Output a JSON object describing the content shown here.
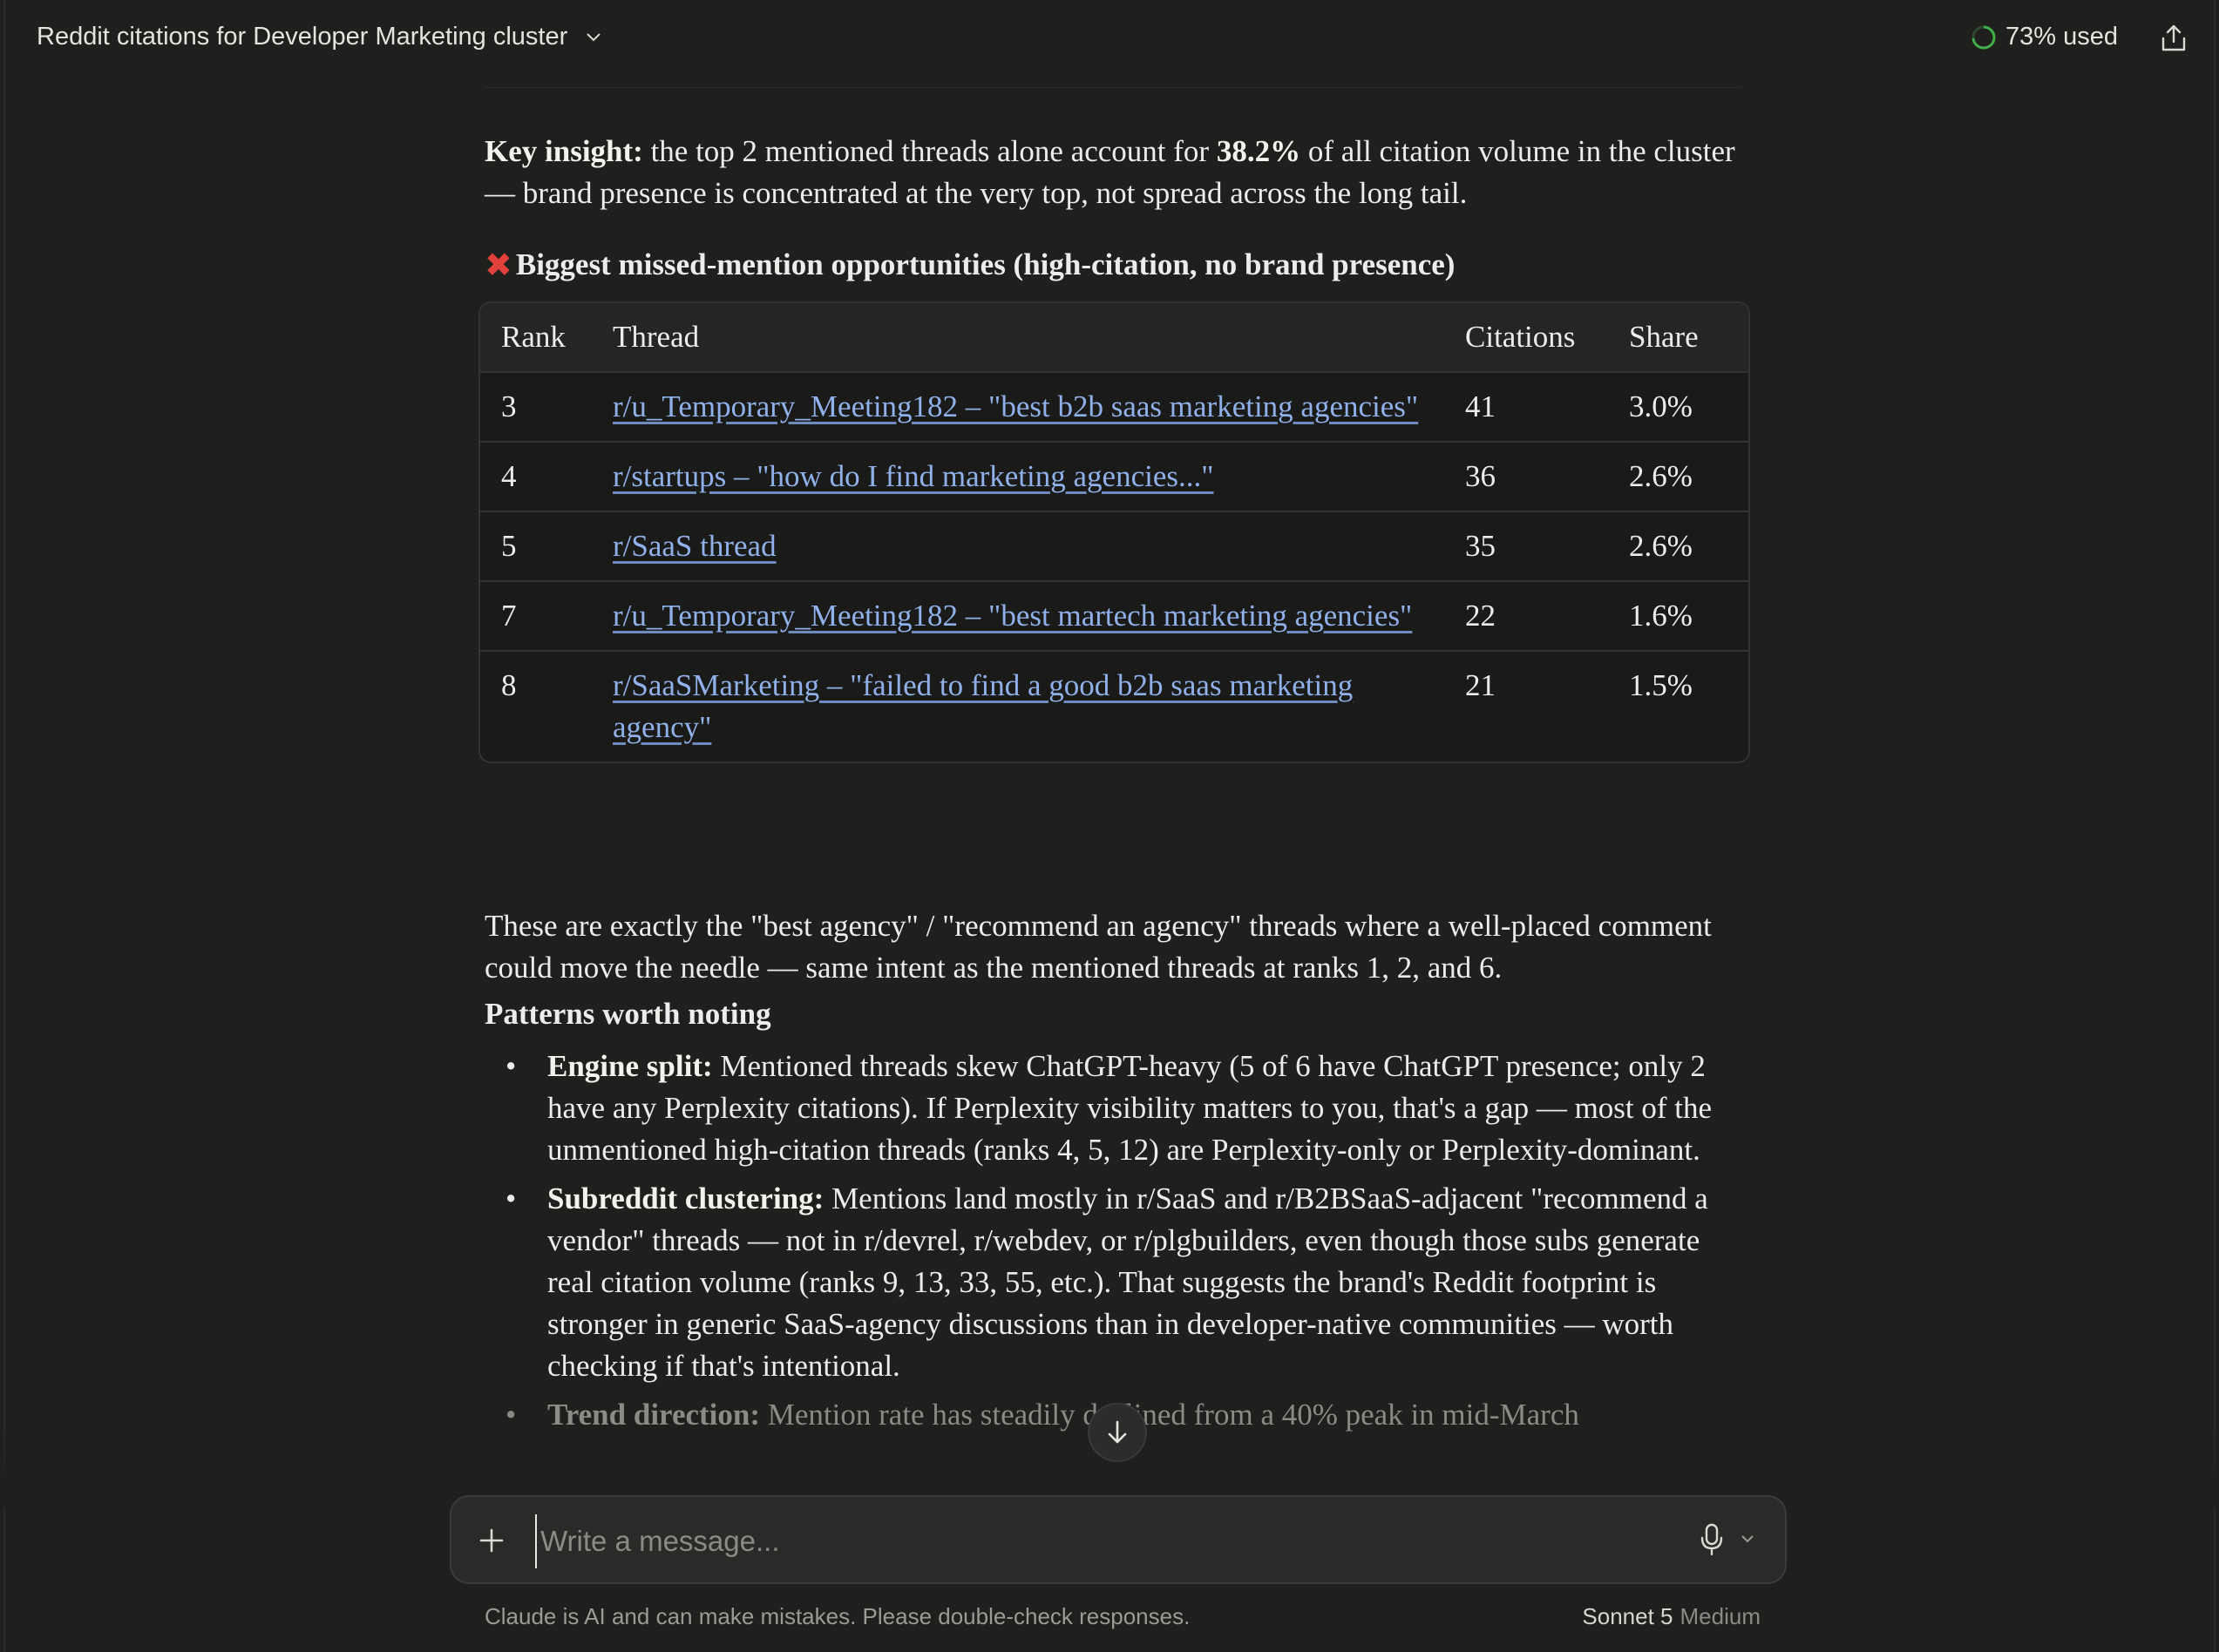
{
  "header": {
    "title": "Reddit citations for Developer Marketing cluster",
    "usage_label": "73% used",
    "usage_fraction": 0.73
  },
  "content": {
    "key_insight_label": "Key insight:",
    "key_insight_pre": " the top 2 mentioned threads alone account for ",
    "key_insight_value": "38.2%",
    "key_insight_post": " of all citation volume in the cluster — brand presence is concentrated at the very top, not spread across the long tail.",
    "missed_heading": "Biggest missed-mention opportunities (high-citation, no brand presence)",
    "table": {
      "headers": [
        "Rank",
        "Thread",
        "Citations",
        "Share"
      ],
      "rows": [
        {
          "rank": "3",
          "thread": "r/u_Temporary_Meeting182 – \"best b2b saas marketing agencies\"",
          "citations": "41",
          "share": "3.0%"
        },
        {
          "rank": "4",
          "thread": "r/startups – \"how do I find marketing agencies...\"",
          "citations": "36",
          "share": "2.6%"
        },
        {
          "rank": "5",
          "thread": "r/SaaS thread",
          "citations": "35",
          "share": "2.6%"
        },
        {
          "rank": "7",
          "thread": "r/u_Temporary_Meeting182 – \"best martech marketing agencies\"",
          "citations": "22",
          "share": "1.6%"
        },
        {
          "rank": "8",
          "thread": "r/SaaSMarketing – \"failed to find a good b2b saas marketing agency\"",
          "citations": "21",
          "share": "1.5%"
        }
      ]
    },
    "after_table": "These are exactly the \"best agency\" / \"recommend an agency\" threads where a well-placed comment could move the needle — same intent as the mentioned threads at ranks 1, 2, and 6.",
    "patterns_heading": "Patterns worth noting",
    "bullets": [
      {
        "label": "Engine split:",
        "text": " Mentioned threads skew ChatGPT-heavy (5 of 6 have ChatGPT presence; only 2 have any Perplexity citations). If Perplexity visibility matters to you, that's a gap — most of the unmentioned high-citation threads (ranks 4, 5, 12) are Perplexity-only or Perplexity-dominant."
      },
      {
        "label": "Subreddit clustering:",
        "text": " Mentions land mostly in r/SaaS and r/B2BSaaS-adjacent \"recommend a vendor\" threads — not in r/devrel, r/webdev, or r/plgbuilders, even though those subs generate real citation volume (ranks 9, 13, 33, 55, etc.). That suggests the brand's Reddit footprint is stronger in generic SaaS-agency discussions than in developer-native communities — worth checking if that's intentional."
      },
      {
        "label": "Trend direction:",
        "text": " Mention rate has steadily declined from a 40% peak in mid-March"
      }
    ]
  },
  "composer": {
    "placeholder": "Write a message...",
    "disclaimer": "Claude is AI and can make mistakes. Please double-check responses.",
    "model_name": "Sonnet 5",
    "model_level": "Medium"
  },
  "colors": {
    "background": "#1f1f1e",
    "link": "#8fb0e8",
    "usage_ring": "#3fae49",
    "x_mark": "#e0413a"
  },
  "icons": [
    "chevron-down-icon",
    "usage-ring-icon",
    "share-icon",
    "x-mark-icon",
    "arrow-down-icon",
    "plus-icon",
    "microphone-icon"
  ]
}
